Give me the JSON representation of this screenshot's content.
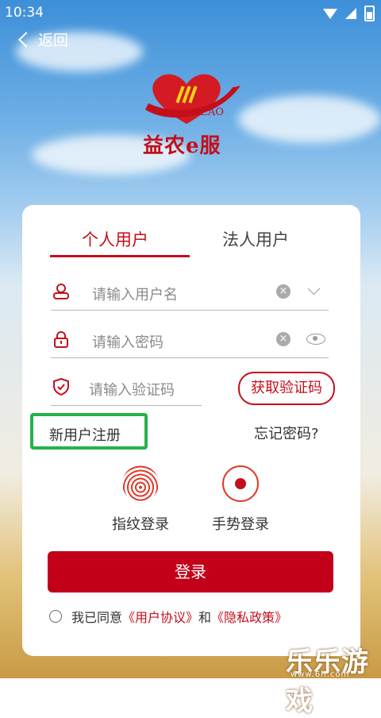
{
  "status": {
    "time": "10:34"
  },
  "nav": {
    "back_label": "返回"
  },
  "logo": {
    "abbr": "AEAO",
    "brand": "益农e服"
  },
  "tabs": {
    "personal": "个人用户",
    "corporate": "法人用户"
  },
  "form": {
    "username_placeholder": "请输入用户名",
    "password_placeholder": "请输入密码",
    "code_placeholder": "请输入验证码",
    "get_code_label": "获取验证码"
  },
  "links": {
    "register": "新用户注册",
    "forgot": "忘记密码?"
  },
  "alt_login": {
    "fingerprint": "指纹登录",
    "gesture": "手势登录"
  },
  "login_button": "登录",
  "agreement": {
    "prefix": "我已同意",
    "user_agreement": "《用户协议》",
    "and": "和",
    "privacy": "《隐私政策》"
  },
  "watermark": {
    "text": "乐乐游戏",
    "url": "www.6ll.com"
  },
  "colors": {
    "accent": "#c40f1b",
    "highlight": "#24b24b"
  }
}
